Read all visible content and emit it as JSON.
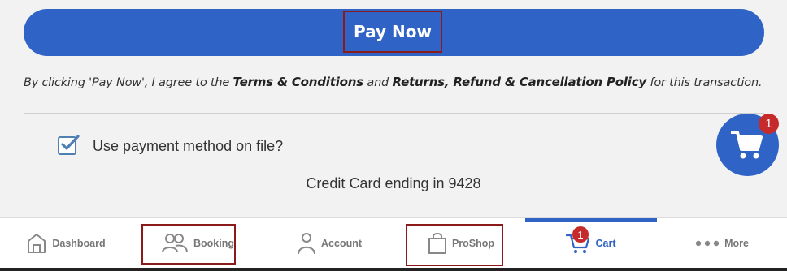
{
  "payment": {
    "pay_now_label": "Pay Now",
    "terms": {
      "prefix": "By clicking 'Pay Now', I agree to the ",
      "terms_link": "Terms & Conditions",
      "and_text": " and ",
      "policy_link": "Returns, Refund & Cancellation Policy",
      "suffix": " for this transaction."
    },
    "use_payment_method_label": "Use payment method on file?",
    "use_payment_method_checked": true,
    "credit_card_text": "Credit Card ending in 9428"
  },
  "floating_cart": {
    "icon": "cart-icon",
    "badge_count": "1"
  },
  "tabbar": {
    "active_tab": "Cart",
    "items": [
      {
        "label": "Dashboard",
        "icon": "home-icon"
      },
      {
        "label": "Booking",
        "icon": "users-icon"
      },
      {
        "label": "Account",
        "icon": "person-icon"
      },
      {
        "label": "ProShop",
        "icon": "shopping-bag-icon"
      },
      {
        "label": "Cart",
        "icon": "cart-icon",
        "badge": "1"
      },
      {
        "label": "More",
        "icon": "more-dots-icon"
      }
    ]
  },
  "colors": {
    "primary": "#2f63c6",
    "badge": "#c62b2b",
    "highlight_border": "#8b1a1a",
    "background": "#f2f2f2"
  }
}
